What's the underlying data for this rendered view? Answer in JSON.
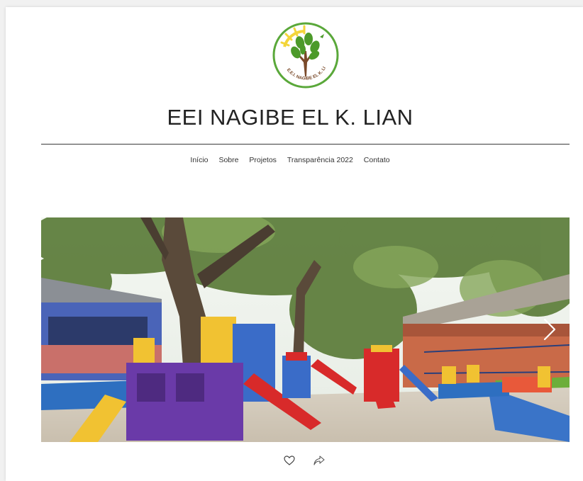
{
  "site": {
    "title": "EEI NAGIBE EL K. LIAN",
    "logo_text": "E.E.I. NAGIBE EL K. LIAN",
    "logo_icon": "tree-icon"
  },
  "nav": {
    "items": [
      {
        "label": "Início"
      },
      {
        "label": "Sobre"
      },
      {
        "label": "Projetos"
      },
      {
        "label": "Transparência 2022"
      },
      {
        "label": "Contato"
      }
    ]
  },
  "slideshow": {
    "image": "playground-photo",
    "next_icon": "chevron-right-icon"
  },
  "social": {
    "like_icon": "heart-icon",
    "share_icon": "share-icon"
  },
  "colors": {
    "logo_ring": "#5aa83a",
    "logo_sun": "#f3d53a",
    "tree_leaf": "#4c9a2a",
    "tree_trunk": "#7a4a2a"
  }
}
